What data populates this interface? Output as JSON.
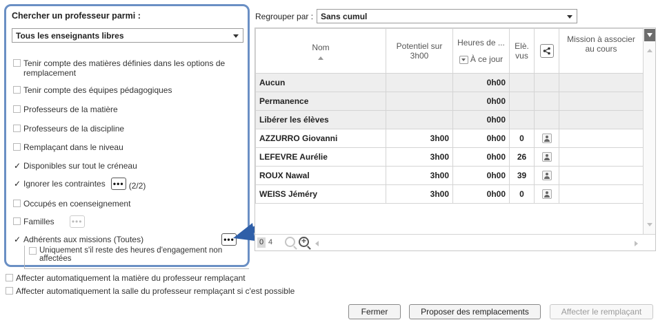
{
  "left": {
    "title": "Chercher un professeur parmi :",
    "teacher_select": "Tous les enseignants libres",
    "options": [
      {
        "label": "Tenir compte des matières définies dans les options de remplacement",
        "checked": false
      },
      {
        "label": "Tenir compte des équipes pédagogiques",
        "checked": false
      },
      {
        "label": "Professeurs de la matière",
        "checked": false
      },
      {
        "label": "Professeurs de la discipline",
        "checked": false
      },
      {
        "label": "Remplaçant dans le niveau",
        "checked": false
      },
      {
        "label": "Disponibles sur tout le créneau",
        "checked": true
      },
      {
        "label": "Ignorer les contraintes",
        "checked": true,
        "count": "(2/2)"
      },
      {
        "label": "Occupés en coenseignement",
        "checked": false
      },
      {
        "label": "Familles",
        "checked": false
      },
      {
        "label": "Adhérents aux missions (Toutes)",
        "checked": true
      },
      {
        "label": "Uniquement s'il reste des heures d'engagement non affectées",
        "checked": false
      }
    ],
    "dots_label": "•••"
  },
  "right": {
    "group_label": "Regrouper par :",
    "group_value": "Sans cumul",
    "columns": {
      "nom": "Nom",
      "potentiel": "Potentiel sur 3h00",
      "heures": "Heures de ...",
      "heures_sub": "À ce jour",
      "eleves": "Elè. vus",
      "mission": "Mission à associer au cours"
    },
    "rows": [
      {
        "nom": "Aucun",
        "potentiel": "",
        "heures": "0h00",
        "eleves": "",
        "grey": true,
        "icon": false
      },
      {
        "nom": "Permanence",
        "potentiel": "",
        "heures": "0h00",
        "eleves": "",
        "grey": true,
        "icon": false
      },
      {
        "nom": "Libérer les élèves",
        "potentiel": "",
        "heures": "0h00",
        "eleves": "",
        "grey": true,
        "icon": false
      },
      {
        "nom": "AZZURRO Giovanni",
        "potentiel": "3h00",
        "heures": "0h00",
        "eleves": "0",
        "grey": false,
        "icon": true
      },
      {
        "nom": "LEFEVRE Aurélie",
        "potentiel": "3h00",
        "heures": "0h00",
        "eleves": "26",
        "grey": false,
        "icon": true
      },
      {
        "nom": "ROUX Nawal",
        "potentiel": "3h00",
        "heures": "0h00",
        "eleves": "39",
        "grey": false,
        "icon": true
      },
      {
        "nom": "WEISS Jéméry",
        "potentiel": "3h00",
        "heures": "0h00",
        "eleves": "0",
        "grey": false,
        "icon": true
      }
    ],
    "pager": {
      "count_shown": "0",
      "total": "4"
    }
  },
  "bottom": {
    "opt1": "Affecter automatiquement la matière du professeur remplaçant",
    "opt2": "Affecter automatiquement la salle du professeur remplaçant si c'est possible",
    "btn_close": "Fermer",
    "btn_propose": "Proposer des remplacements",
    "btn_assign": "Affecter le remplaçant"
  },
  "colors": {
    "panel_border": "#6a8fc4",
    "arrow": "#2f5fa8",
    "grey_row": "#eeeeee"
  }
}
